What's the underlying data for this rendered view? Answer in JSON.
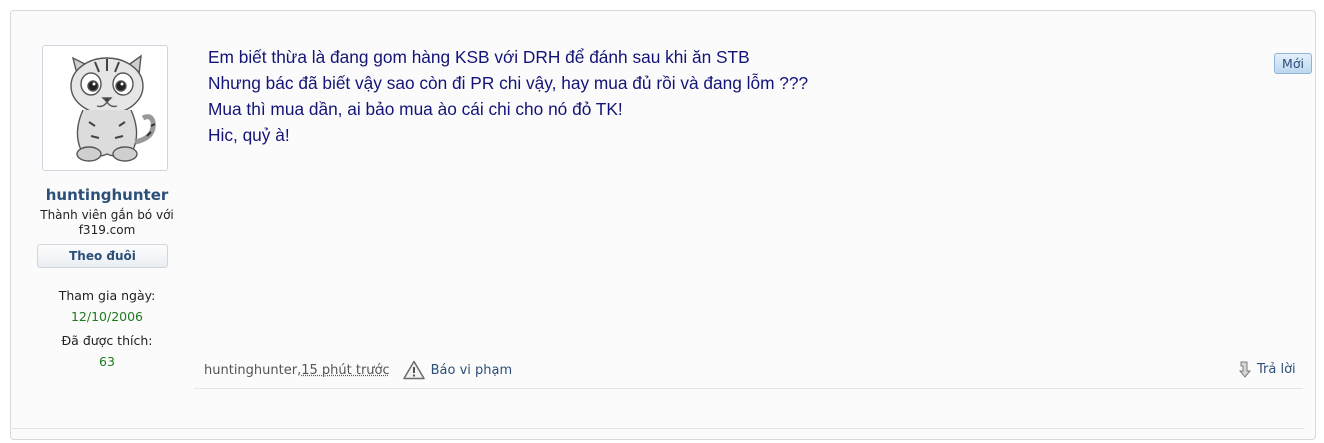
{
  "post": {
    "author": {
      "username": "huntinghunter",
      "title": "Thành viên gắn bó với f319.com",
      "follow_label": "Theo đuôi",
      "joined_label": "Tham gia ngày:",
      "joined_value": "12/10/2006",
      "likes_label": "Đã được thích:",
      "likes_value": "63"
    },
    "message_lines": [
      "Em biết thừa là đang gom hàng KSB với DRH để đánh sau khi ăn STB",
      "Nhưng bác đã biết vậy sao còn đi PR chi vậy, hay mua đủ rồi và đang lỗm ???",
      "Mua thì mua dần, ai bảo mua ào cái chi cho nó đỏ TK!",
      "Hic, quỷ à!"
    ],
    "badge_new": "Mới",
    "footer": {
      "author": "huntinghunter",
      "separator": ", ",
      "time": "15 phút trước",
      "report_label": "Báo vi phạm",
      "reply_label": "Trả lời"
    }
  },
  "icons": {
    "avatar": "tiger-cub-sketch",
    "report": "warning-triangle-icon",
    "reply": "reply-arrow-icon"
  },
  "colors": {
    "username": "#2b4f77",
    "message_text": "#141478",
    "stat_value": "#1d7a1d"
  }
}
